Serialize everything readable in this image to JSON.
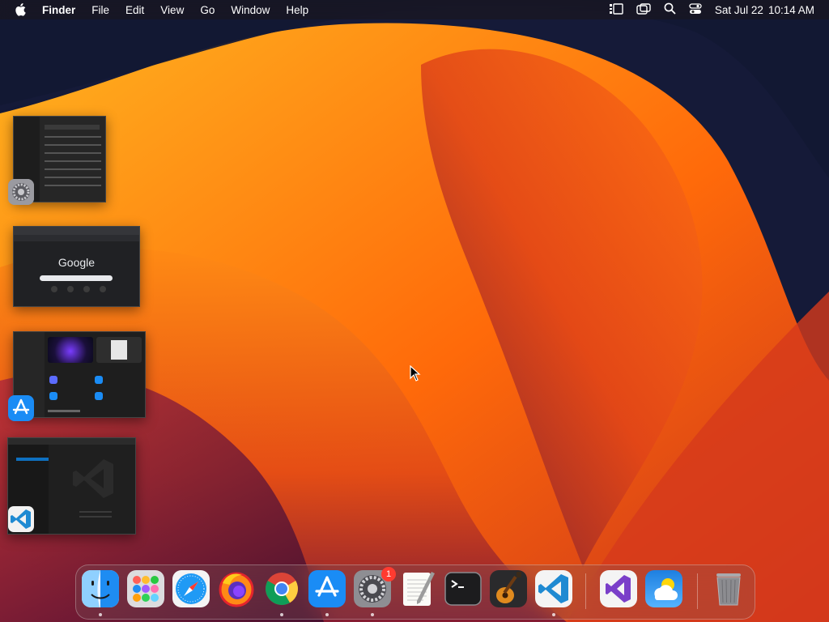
{
  "menubar": {
    "app_name": "Finder",
    "menus": [
      "File",
      "Edit",
      "View",
      "Go",
      "Window",
      "Help"
    ],
    "status_icons": [
      "reading-list-icon",
      "screen-mirroring-icon",
      "spotlight-search-icon",
      "control-center-icon"
    ],
    "date": "Sat Jul 22",
    "time": "10:14 AM"
  },
  "expose_windows": [
    {
      "app": "System Settings",
      "app_icon": "gear-icon"
    },
    {
      "app": "Google Chrome",
      "app_icon": "chrome-icon",
      "page_logo": "Google"
    },
    {
      "app": "App Store",
      "app_icon": "app-store-icon"
    },
    {
      "app": "Visual Studio Code",
      "app_icon": "vscode-icon"
    }
  ],
  "dock": {
    "apps": [
      {
        "name": "Finder",
        "icon": "finder-icon",
        "running": true
      },
      {
        "name": "Launchpad",
        "icon": "launchpad-icon",
        "running": false
      },
      {
        "name": "Safari",
        "icon": "safari-icon",
        "running": false
      },
      {
        "name": "Firefox",
        "icon": "firefox-icon",
        "running": false
      },
      {
        "name": "Google Chrome",
        "icon": "chrome-icon",
        "running": true
      },
      {
        "name": "App Store",
        "icon": "app-store-icon",
        "running": true
      },
      {
        "name": "System Settings",
        "icon": "gear-icon",
        "running": true,
        "badge": "1"
      },
      {
        "name": "TextEdit",
        "icon": "textedit-icon",
        "running": false
      },
      {
        "name": "Terminal",
        "icon": "terminal-icon",
        "running": false
      },
      {
        "name": "GarageBand",
        "icon": "garageband-icon",
        "running": false
      },
      {
        "name": "Visual Studio Code",
        "icon": "vscode-icon",
        "running": true
      }
    ],
    "recent_apps": [
      {
        "name": "Visual Studio",
        "icon": "visual-studio-icon"
      },
      {
        "name": "Weather",
        "icon": "weather-icon"
      }
    ],
    "trash": {
      "name": "Trash",
      "icon": "trash-icon"
    }
  },
  "colors": {
    "badge": "#ff3b30",
    "vscode_blue": "#1f8ad2",
    "appstore_blue": "#1a8cf5"
  }
}
